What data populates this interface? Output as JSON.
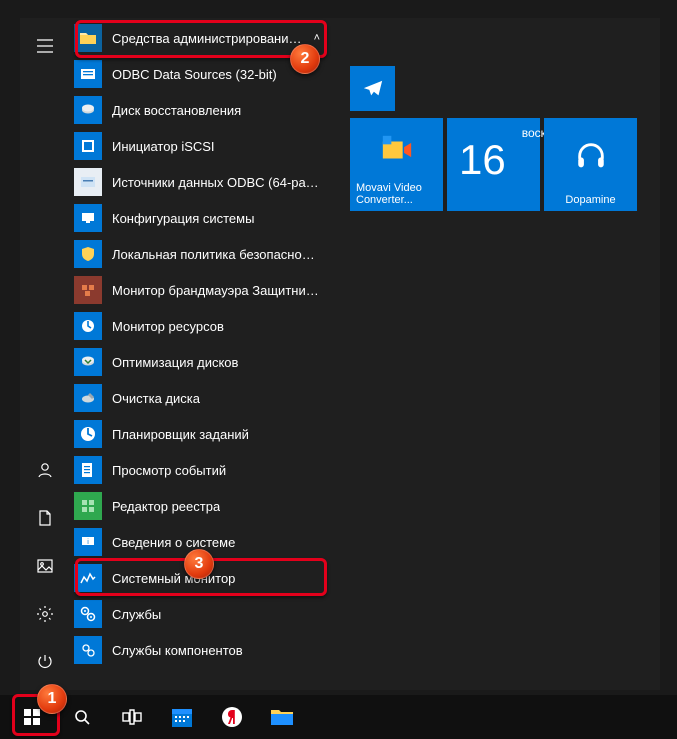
{
  "header": {
    "group_label": "Средства администрирования..."
  },
  "apps": {
    "i0": "ODBC Data Sources (32-bit)",
    "i1": "Диск восстановления",
    "i2": "Инициатор iSCSI",
    "i3": "Источники данных ODBC (64-раз...",
    "i4": "Конфигурация системы",
    "i5": "Локальная политика безопасности",
    "i6": "Монитор брандмауэра Защитник...",
    "i7": "Монитор ресурсов",
    "i8": "Оптимизация дисков",
    "i9": "Очистка диска",
    "i10": "Планировщик заданий",
    "i11": "Просмотр событий",
    "i12": "Редактор реестра",
    "i13": "Сведения о системе",
    "i14": "Системный монитор",
    "i15": "Службы",
    "i16": "Службы компонентов"
  },
  "tiles": {
    "movavi": "Movavi Video Converter...",
    "dopamine": "Dopamine",
    "cal_dow": "воскресенье",
    "cal_num": "16"
  },
  "markers": {
    "m1": "1",
    "m2": "2",
    "m3": "3"
  }
}
